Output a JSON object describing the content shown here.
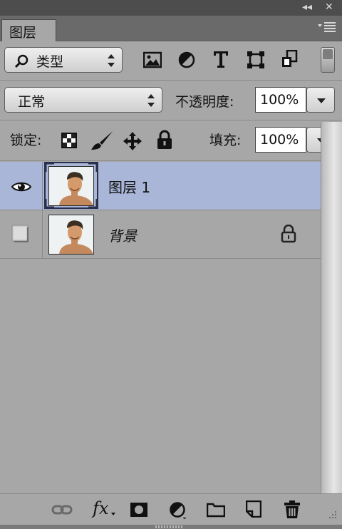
{
  "titlebar": {
    "collapse_glyph": "◂◂",
    "close_glyph": "✕"
  },
  "tab": {
    "label": "图层"
  },
  "filter": {
    "kind_label": "类型",
    "search_icon": "search-icon"
  },
  "filter_icons": [
    "image-icon",
    "adjustment-icon",
    "type-icon",
    "shape-icon",
    "smart-object-icon"
  ],
  "blend": {
    "mode": "正常",
    "opacity_label": "不透明度:",
    "opacity_value": "100%"
  },
  "lock": {
    "label": "锁定:",
    "fill_label": "填充:",
    "fill_value": "100%"
  },
  "layers": [
    {
      "name": "图层 1",
      "visible": true,
      "selected": true,
      "locked": false
    },
    {
      "name": "背景",
      "visible": false,
      "selected": false,
      "locked": true
    }
  ],
  "bottom_icons": [
    "link-icon",
    "fx-icon",
    "mask-icon",
    "adjustment-layer-icon",
    "group-folder-icon",
    "new-layer-icon",
    "trash-icon"
  ],
  "bottom": {
    "fx_label": "fx"
  },
  "colors": {
    "selected_row": "#a9b6d8",
    "panel_bg": "#a7a7a7"
  }
}
